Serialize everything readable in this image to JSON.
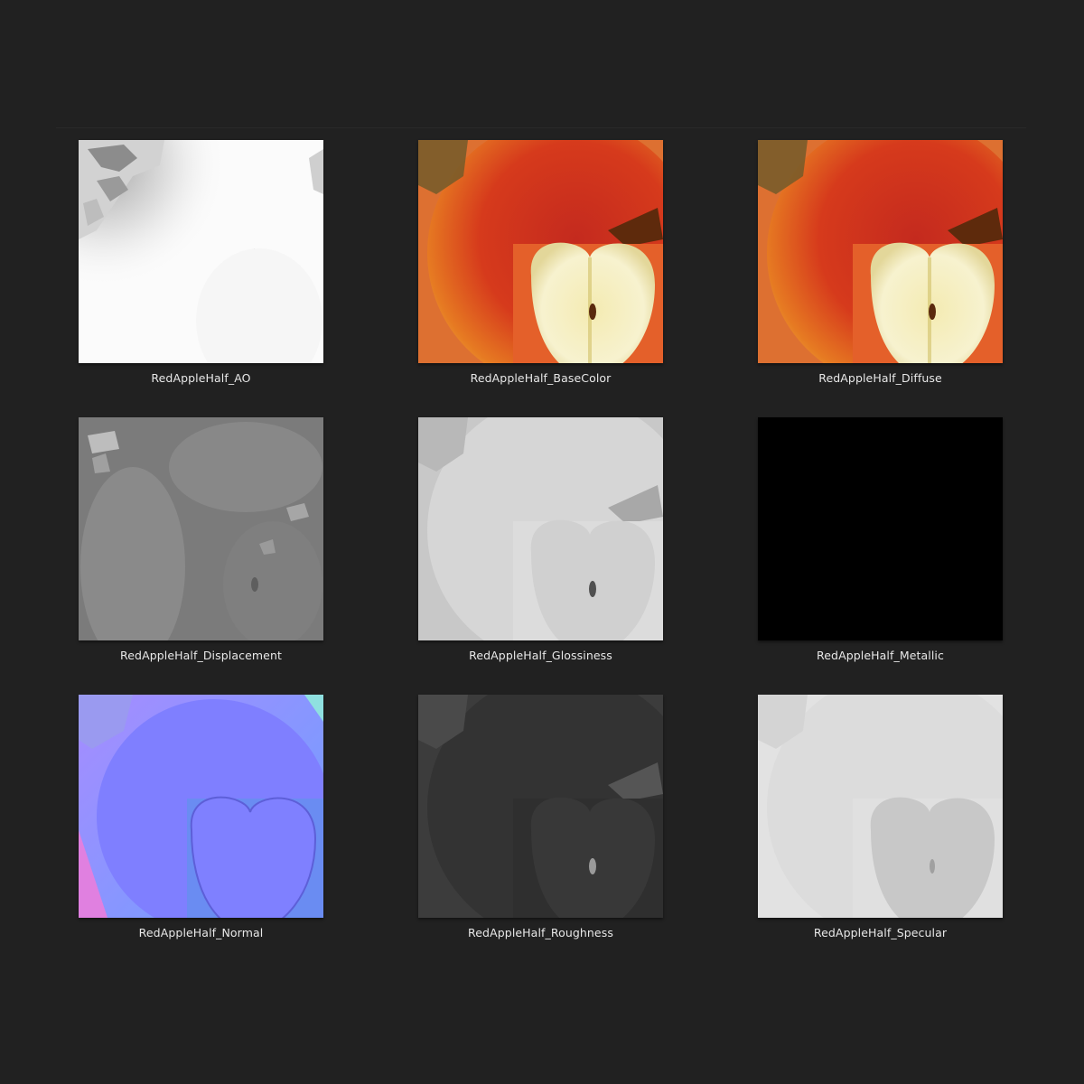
{
  "files": [
    {
      "name": "RedAppleHalf_AO",
      "kind": "ao"
    },
    {
      "name": "RedAppleHalf_BaseColor",
      "kind": "basecolor"
    },
    {
      "name": "RedAppleHalf_Diffuse",
      "kind": "diffuse"
    },
    {
      "name": "RedAppleHalf_Displacement",
      "kind": "displacement"
    },
    {
      "name": "RedAppleHalf_Glossiness",
      "kind": "glossiness"
    },
    {
      "name": "RedAppleHalf_Metallic",
      "kind": "metallic"
    },
    {
      "name": "RedAppleHalf_Normal",
      "kind": "normal"
    },
    {
      "name": "RedAppleHalf_Roughness",
      "kind": "roughness"
    },
    {
      "name": "RedAppleHalf_Specular",
      "kind": "specular"
    }
  ],
  "colors": {
    "background": "#212121",
    "caption": "#e8e8e8"
  }
}
